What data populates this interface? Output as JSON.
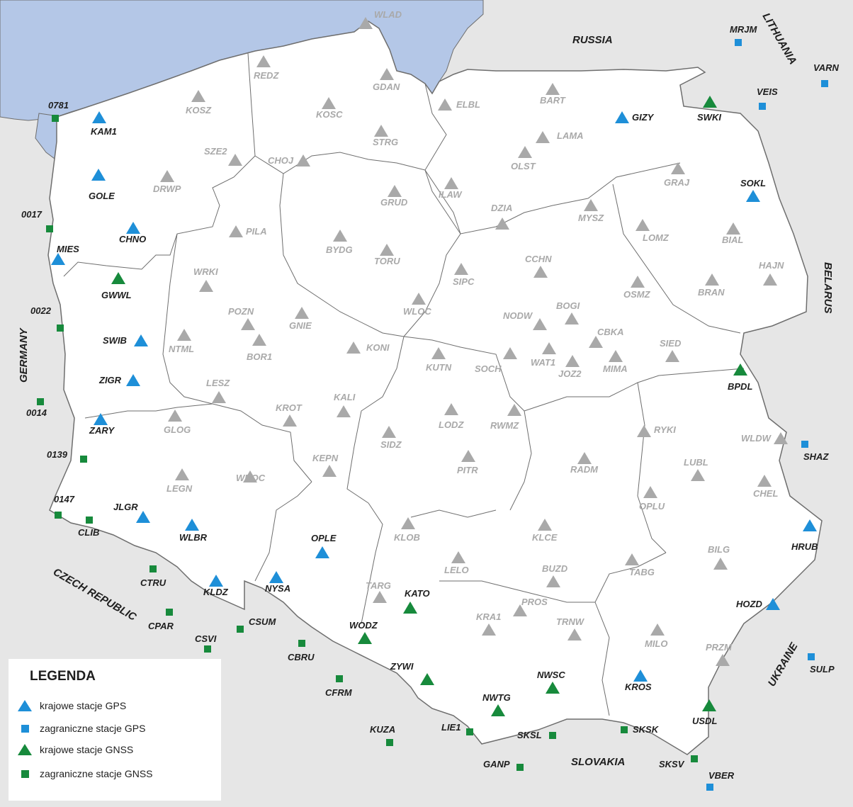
{
  "colors": {
    "sea": "#b4c7e7",
    "neighbors": "#e6e6e6",
    "poland": "#ffffff",
    "border": "#6e6e6e",
    "gps_blue": "#1e8fd8",
    "gnss_green": "#178a3c",
    "grey_station": "#a9a9a9"
  },
  "countries": {
    "russia": "RUSSIA",
    "lithuania": "LITHUANIA",
    "belarus": "BELARUS",
    "ukraine": "UKRAINE",
    "slovakia": "SLOVAKIA",
    "czech": "CZECH REPUBLIC",
    "germany": "GERMANY"
  },
  "legend": {
    "title": "LEGENDA",
    "items": [
      {
        "label": "krajowe stacje GPS",
        "icon": "blue-triangle"
      },
      {
        "label": "zagraniczne stacje GPS",
        "icon": "blue-square"
      },
      {
        "label": "krajowe stacje GNSS",
        "icon": "green-triangle"
      },
      {
        "label": "zagraniczne stacje GNSS",
        "icon": "green-square"
      }
    ]
  },
  "stations": {
    "domestic_gps": [
      "KAM1",
      "GOLE",
      "CHNO",
      "MIES",
      "SWIB",
      "ZIGR",
      "ZARY",
      "JLGR",
      "WLBR",
      "KLDZ",
      "NYSA",
      "OPLE",
      "GIZY",
      "SOKL",
      "HRUB",
      "HOZD",
      "KROS"
    ],
    "foreign_gps": [
      "MRJM",
      "VARN",
      "VEIS",
      "SHAZ",
      "SULP",
      "VBER"
    ],
    "domestic_gnss": [
      "SWKI",
      "GWWL",
      "BPDL",
      "KATO",
      "WODZ",
      "ZYWI",
      "NWTG",
      "NWSC",
      "USDL"
    ],
    "foreign_gnss": [
      "0781",
      "0017",
      "0022",
      "0014",
      "0139",
      "0147",
      "CLIB",
      "CTRU",
      "CPAR",
      "CSVI",
      "CSUM",
      "CBRU",
      "CFRM",
      "KUZA",
      "LIE1",
      "SKSL",
      "SKSK",
      "GANP",
      "SKSV"
    ],
    "other": [
      "WLAD",
      "REDZ",
      "GDAN",
      "KOSZ",
      "KOSC",
      "ELBL",
      "BART",
      "LAMA",
      "STRG",
      "OLST",
      "SZE2",
      "CHOJ",
      "DRWP",
      "GRUD",
      "ILAW",
      "GRAJ",
      "DZIA",
      "MYSZ",
      "PILA",
      "BYDG",
      "TORU",
      "LOMZ",
      "BIAL",
      "CCHN",
      "SIPC",
      "HAJN",
      "WRKI",
      "OSMZ",
      "BRAN",
      "WLOC",
      "POZN",
      "GNIE",
      "NODW",
      "BOGI",
      "NTML",
      "BOR1",
      "KONI",
      "CBKA",
      "SIED",
      "KUTN",
      "SOCH",
      "WAT1",
      "JOZ2",
      "MIMA",
      "LESZ",
      "KALI",
      "KROT",
      "LODZ",
      "RWMZ",
      "GLOG",
      "SIDZ",
      "RYKI",
      "WLDW",
      "KEPN",
      "PITR",
      "RADM",
      "LUBL",
      "LEGN",
      "WROC",
      "CHEL",
      "OPLU",
      "KLOB",
      "KLCE",
      "LELO",
      "BILG",
      "BUZD",
      "TABG",
      "TARG",
      "PROS",
      "KRA1",
      "TRNW",
      "MILO",
      "PRZM"
    ]
  }
}
